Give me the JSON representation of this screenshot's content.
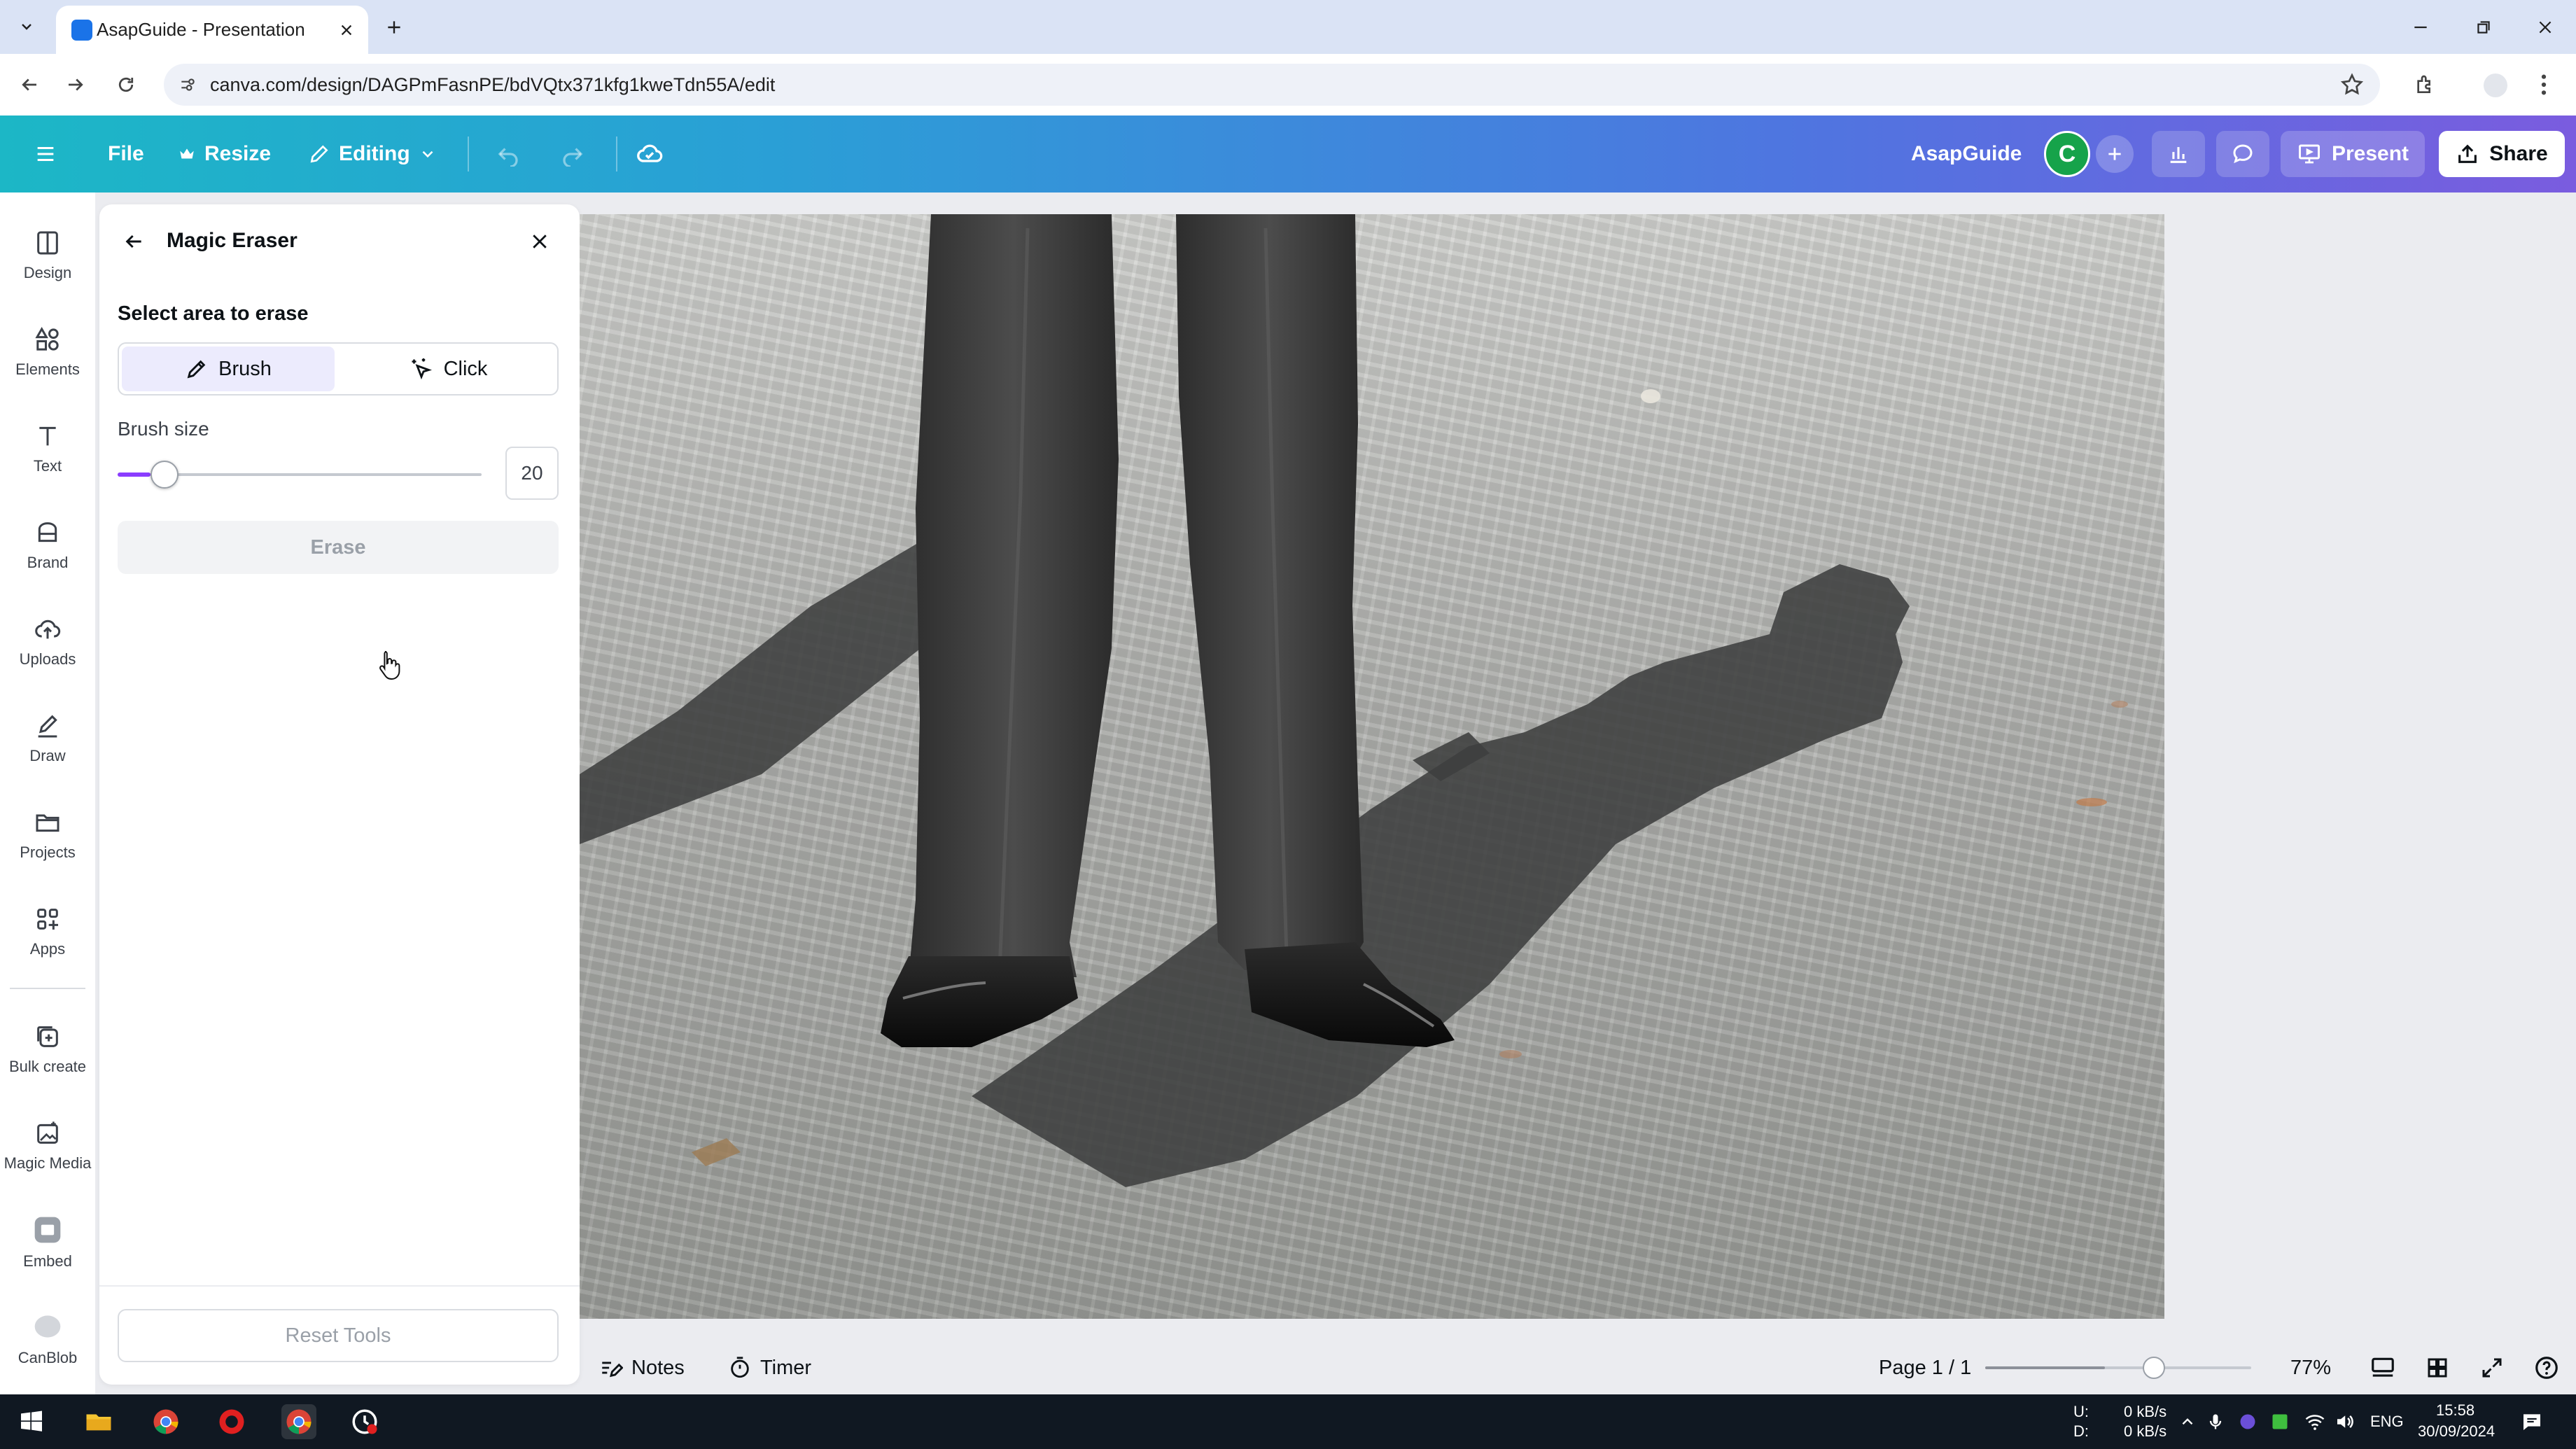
{
  "browser": {
    "tab_title": "AsapGuide - Presentation",
    "url": "canva.com/design/DAGPmFasnPE/bdVQtx371kfg1kweTdn55A/edit"
  },
  "header": {
    "file": "File",
    "resize": "Resize",
    "editing": "Editing",
    "brand": "AsapGuide",
    "avatar_letter": "C",
    "present": "Present",
    "share": "Share"
  },
  "rail": {
    "design": "Design",
    "elements": "Elements",
    "text": "Text",
    "brand": "Brand",
    "uploads": "Uploads",
    "draw": "Draw",
    "projects": "Projects",
    "apps": "Apps",
    "bulk_create": "Bulk create",
    "magic_media": "Magic Media",
    "embed": "Embed",
    "canblob": "CanBlob"
  },
  "panel": {
    "title": "Magic Eraser",
    "section_label": "Select area to erase",
    "mode_brush": "Brush",
    "mode_click": "Click",
    "active_mode": "Brush",
    "brush_size_label": "Brush size",
    "brush_size_value": "20",
    "brush_size_fraction": 0.09,
    "erase": "Erase",
    "reset": "Reset Tools"
  },
  "bottom": {
    "notes": "Notes",
    "timer": "Timer",
    "page": "Page 1 / 1",
    "zoom": "77%",
    "zoom_fraction": 0.45
  },
  "taskbar": {
    "net_up_label": "U:",
    "net_down_label": "D:",
    "net_up": "0 kB/s",
    "net_down": "0 kB/s",
    "lang": "ENG",
    "time": "15:58",
    "date": "30/09/2024"
  },
  "colors": {
    "accent": "#8b3dff",
    "header_start": "#1cb7c6",
    "header_end": "#7a5cdf",
    "avatar": "#16a34a"
  }
}
